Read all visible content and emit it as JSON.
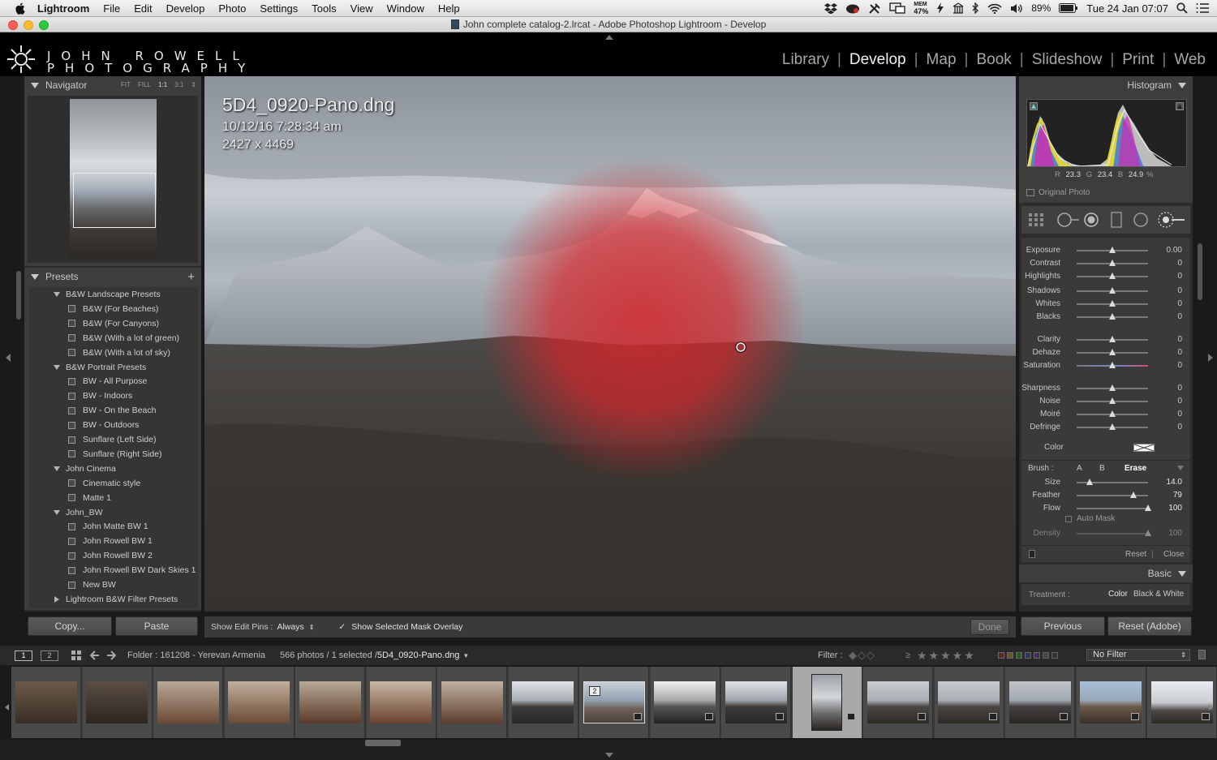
{
  "menubar": {
    "app": "Lightroom",
    "items": [
      "File",
      "Edit",
      "Develop",
      "Photo",
      "Settings",
      "Tools",
      "View",
      "Window",
      "Help"
    ],
    "mem_label": "MEM",
    "mem_value": "47%",
    "battery": "89%",
    "clock": "Tue 24 Jan  07:07"
  },
  "window": {
    "title": "John complete catalog-2.lrcat - Adobe Photoshop Lightroom - Develop"
  },
  "logo": {
    "line1": "JOHN ROWELL",
    "line2": "PHOTOGRAPHY"
  },
  "modules": [
    "Library",
    "Develop",
    "Map",
    "Book",
    "Slideshow",
    "Print",
    "Web"
  ],
  "active_module": "Develop",
  "navigator": {
    "title": "Navigator",
    "modes": [
      "FIT",
      "FILL",
      "1:1",
      "3:1"
    ]
  },
  "presets": {
    "title": "Presets",
    "add": "+",
    "rows": [
      {
        "type": "folder",
        "open": true,
        "label": "B&W Landscape Presets"
      },
      {
        "type": "item",
        "label": "B&W (For Beaches)"
      },
      {
        "type": "item",
        "label": "B&W (For Canyons)"
      },
      {
        "type": "item",
        "label": "B&W (With a lot of green)"
      },
      {
        "type": "item",
        "label": "B&W (With a lot of sky)"
      },
      {
        "type": "folder",
        "open": true,
        "label": "B&W Portrait Presets"
      },
      {
        "type": "item",
        "label": "BW - All Purpose"
      },
      {
        "type": "item",
        "label": "BW - Indoors"
      },
      {
        "type": "item",
        "label": "BW - On the Beach"
      },
      {
        "type": "item",
        "label": "BW - Outdoors"
      },
      {
        "type": "item",
        "label": "Sunflare (Left Side)"
      },
      {
        "type": "item",
        "label": "Sunflare (Right Side)"
      },
      {
        "type": "folder",
        "open": true,
        "label": "John Cinema"
      },
      {
        "type": "item",
        "label": "Cinematic style"
      },
      {
        "type": "item",
        "label": "Matte 1"
      },
      {
        "type": "folder",
        "open": true,
        "label": "John_BW"
      },
      {
        "type": "item",
        "label": "John Matte BW 1"
      },
      {
        "type": "item",
        "label": "John Rowell BW 1"
      },
      {
        "type": "item",
        "label": "John Rowell BW 2"
      },
      {
        "type": "item",
        "label": "John Rowell BW Dark Skies 1"
      },
      {
        "type": "item",
        "label": "New BW"
      },
      {
        "type": "folder",
        "open": false,
        "label": "Lightroom B&W Filter Presets"
      }
    ]
  },
  "left_buttons": {
    "copy": "Copy...",
    "paste": "Paste"
  },
  "photo_info": {
    "filename": "5D4_0920-Pano.dng",
    "datetime": "10/12/16 7:28:34 am",
    "dimensions": "2427 x 4469"
  },
  "toolbar": {
    "edit_pins_label": "Show Edit Pins :",
    "edit_pins_value": "Always",
    "overlay_label": "Show Selected Mask Overlay",
    "overlay_checked": true,
    "done": "Done"
  },
  "histogram": {
    "title": "Histogram",
    "r_label": "R",
    "r_value": "23.3",
    "g_label": "G",
    "g_value": "23.4",
    "b_label": "B",
    "b_value": "24.9",
    "percent": "%",
    "original_photo": "Original Photo"
  },
  "sliders": [
    {
      "label": "Exposure",
      "value": "0.00",
      "pos": 0.5
    },
    {
      "label": "Contrast",
      "value": "0",
      "pos": 0.5
    },
    {
      "label": "Highlights",
      "value": "0",
      "pos": 0.5
    },
    {
      "label": "Shadows",
      "value": "0",
      "pos": 0.5
    },
    {
      "label": "Whites",
      "value": "0",
      "pos": 0.5
    },
    {
      "label": "Blacks",
      "value": "0",
      "pos": 0.5
    },
    {
      "label": "Clarity",
      "value": "0",
      "pos": 0.5
    },
    {
      "label": "Dehaze",
      "value": "0",
      "pos": 0.5
    },
    {
      "label": "Saturation",
      "value": "0",
      "pos": 0.5
    },
    {
      "label": "Sharpness",
      "value": "0",
      "pos": 0.5
    },
    {
      "label": "Noise",
      "value": "0",
      "pos": 0.5
    },
    {
      "label": "Moiré",
      "value": "0",
      "pos": 0.5
    },
    {
      "label": "Defringe",
      "value": "0",
      "pos": 0.5
    }
  ],
  "color_label": "Color",
  "brush": {
    "label": "Brush :",
    "a": "A",
    "b": "B",
    "erase": "Erase",
    "rows": [
      {
        "label": "Size",
        "value": "14.0",
        "pos": 0.18
      },
      {
        "label": "Feather",
        "value": "79",
        "pos": 0.79
      },
      {
        "label": "Flow",
        "value": "100",
        "pos": 1.0
      }
    ],
    "auto_mask": "Auto Mask",
    "density_label": "Density",
    "density_value": "100",
    "density_pos": 1.0,
    "reset": "Reset",
    "close": "Close"
  },
  "basic": {
    "title": "Basic",
    "treatment_label": "Treatment :",
    "color": "Color",
    "bw": "Black & White"
  },
  "right_buttons": {
    "previous": "Previous",
    "reset": "Reset (Adobe)"
  },
  "filmbar": {
    "screen1": "1",
    "screen2": "2",
    "folder": "Folder : 161208 - Yerevan Armenia",
    "count": "566 photos / 1 selected /",
    "selected_file": "5D4_0920-Pano.dng",
    "filter_label": "Filter :",
    "rating_op": "≥",
    "stars": "★★★★★",
    "no_filter": "No Filter"
  },
  "film_badge": "2",
  "colors": {
    "accent_mask": "#d4262a",
    "panel": "#3b3b3b",
    "bg": "#1a1a1a"
  }
}
